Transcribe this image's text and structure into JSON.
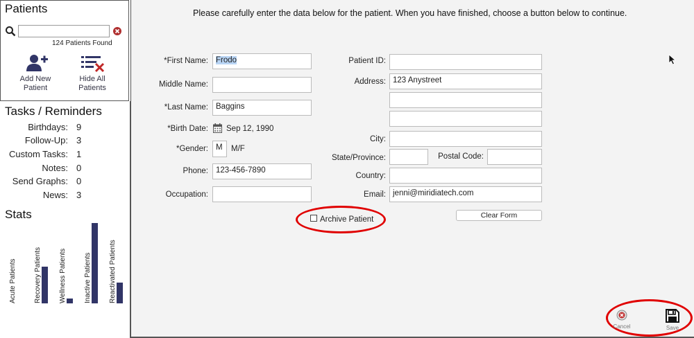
{
  "patients": {
    "title": "Patients",
    "search_value": "",
    "found_text": "124 Patients Found",
    "add_new_label": "Add New Patient",
    "add_new_line1": "Add New",
    "add_new_line2": "Patient",
    "hide_all_line1": "Hide All",
    "hide_all_line2": "Patients"
  },
  "tasks": {
    "title": "Tasks / Reminders",
    "items": [
      {
        "label": "Birthdays:",
        "value": "9"
      },
      {
        "label": "Follow-Up:",
        "value": "3"
      },
      {
        "label": "Custom Tasks:",
        "value": "1"
      },
      {
        "label": "Notes:",
        "value": "0"
      },
      {
        "label": "Send Graphs:",
        "value": "0"
      },
      {
        "label": "News:",
        "value": "3"
      }
    ]
  },
  "stats": {
    "title": "Stats",
    "bars": [
      {
        "label": "Acute Patients",
        "value": 0
      },
      {
        "label": "Recovery Patients",
        "value": 53
      },
      {
        "label": "Wellness Patients",
        "value": 7
      },
      {
        "label": "Inactive Patients",
        "value": 115
      },
      {
        "label": "Reactivated Patients",
        "value": 30
      }
    ]
  },
  "form": {
    "instructions": "Please carefully enter the data below for the patient.  When you have finished, choose a button below to continue.",
    "labels": {
      "first_name": "*First Name:",
      "middle_name": "Middle Name:",
      "last_name": "*Last Name:",
      "birth_date": "*Birth Date:",
      "gender": "*Gender:",
      "phone": "Phone:",
      "occupation": "Occupation:",
      "patient_id": "Patient ID:",
      "address": "Address:",
      "city": "City:",
      "state": "State/Province:",
      "postal": "Postal Code:",
      "country": "Country:",
      "email": "Email:"
    },
    "values": {
      "first_name": "Frodo",
      "middle_name": "",
      "last_name": "Baggins",
      "birth_date": "Sep 12, 1990",
      "gender": "M",
      "gender_hint": "M/F",
      "phone": "123-456-7890",
      "occupation": "",
      "patient_id": "",
      "address1": "123 Anystreet",
      "address2": "",
      "address3": "",
      "city": "",
      "state": "",
      "postal": "",
      "country": "",
      "email": "jenni@miridiatech.com"
    },
    "archive_label": "Archive Patient",
    "clear_label": "Clear Form"
  },
  "actions": {
    "cancel_label": "Cancel",
    "save_label": "Save"
  },
  "colors": {
    "bar": "#313567",
    "highlight": "#e00000"
  }
}
